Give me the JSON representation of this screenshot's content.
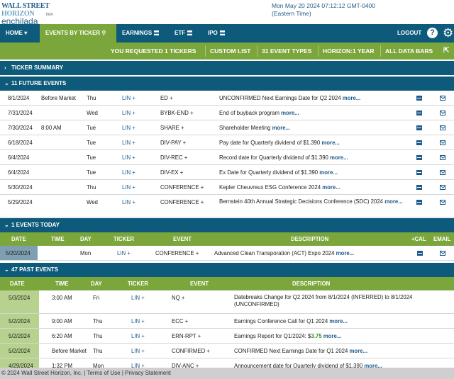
{
  "brand": {
    "line1_a": "WALL STREET ",
    "line1_b": "HORIZON",
    "line2": "enchilada",
    "tmx": "TMX"
  },
  "datetime": {
    "line1": "Mon May 20 2024 07:12:12 GMT-0400",
    "line2": "(Eastern Time)"
  },
  "nav": {
    "home": "HOME",
    "events_by_ticker": "EVENTS BY TICKER",
    "earnings": "EARNINGS",
    "etf": "ETF",
    "ipo": "IPO",
    "logout": "LOGOUT"
  },
  "subnav": {
    "requested": "YOU REQUESTED 1 TICKERS",
    "custom_list": "CUSTOM LIST",
    "event_types": "31 EVENT TYPES",
    "horizon": "HORIZON:1 YEAR",
    "data_bars": "ALL DATA BARS"
  },
  "sections": {
    "ticker_summary": "TICKER SUMMARY",
    "future": "11 FUTURE EVENTS",
    "today": "1 EVENTS TODAY",
    "past": "47 PAST EVENTS"
  },
  "more": "more...",
  "future_events": [
    {
      "date": "8/1/2024",
      "time": "Before Market",
      "day": "Thu",
      "ticker": "LIN +",
      "event": "ED +",
      "desc": "UNCONFIRMED Next Earnings Date for Q2 2024"
    },
    {
      "date": "7/31/2024",
      "time": "",
      "day": "Wed",
      "ticker": "LIN +",
      "event": "BYBK-END +",
      "desc": "End of buyback program"
    },
    {
      "date": "7/30/2024",
      "time": "8:00 AM",
      "day": "Tue",
      "ticker": "LIN +",
      "event": "SHARE +",
      "desc": "Shareholder Meeting"
    },
    {
      "date": "6/18/2024",
      "time": "",
      "day": "Tue",
      "ticker": "LIN +",
      "event": "DIV-PAY +",
      "desc": "Pay date for Quarterly dividend of $1.390"
    },
    {
      "date": "6/4/2024",
      "time": "",
      "day": "Tue",
      "ticker": "LIN +",
      "event": "DIV-REC +",
      "desc": "Record date for Quarterly dividend of $1.390"
    },
    {
      "date": "6/4/2024",
      "time": "",
      "day": "Tue",
      "ticker": "LIN +",
      "event": "DIV-EX +",
      "desc": "Ex Date for Quarterly dividend of $1.390"
    },
    {
      "date": "5/30/2024",
      "time": "",
      "day": "Thu",
      "ticker": "LIN +",
      "event": "CONFERENCE +",
      "desc": "Kepler Cheuvreux ESG Conference 2024"
    },
    {
      "date": "5/29/2024",
      "time": "",
      "day": "Wed",
      "ticker": "LIN +",
      "event": "CONFERENCE +",
      "desc": "Bernstein 40th Annual Strategic Decisions Conference (SDC) 2024"
    }
  ],
  "today_header": {
    "date": "DATE",
    "time": "TIME",
    "day": "DAY",
    "ticker": "TICKER",
    "event": "EVENT",
    "desc": "DESCRIPTION",
    "cal": "+CAL",
    "email": "EMAIL"
  },
  "today_events": [
    {
      "date": "5/20/2024",
      "time": "",
      "day": "Mon",
      "ticker": "LIN +",
      "event": "CONFERENCE +",
      "desc": "Advanced Clean Transporation (ACT) Expo 2024"
    }
  ],
  "past_header": {
    "date": "DATE",
    "time": "TIME",
    "day": "DAY",
    "ticker": "TICKER",
    "event": "EVENT",
    "desc": "DESCRIPTION"
  },
  "past_events": [
    {
      "date": "5/3/2024",
      "time": "3:00 AM",
      "day": "Fri",
      "ticker": "LIN +",
      "event": "NQ +",
      "desc": "Datebreaks Change for Q2 2024 from 8/1/2024 (INFERRED) to 8/1/2024 (UNCONFIRMED)"
    },
    {
      "date": "5/2/2024",
      "time": "9:00 AM",
      "day": "Thu",
      "ticker": "LIN +",
      "event": "ECC +",
      "desc": "Earnings Conference Call for Q1 2024"
    },
    {
      "date": "5/2/2024",
      "time": "6:20 AM",
      "day": "Thu",
      "ticker": "LIN +",
      "event": "ERN-RPT +",
      "desc": "Earnings Report for Q1/2024: $",
      "eps": "3.75"
    },
    {
      "date": "5/2/2024",
      "time": "Before Market",
      "day": "Thu",
      "ticker": "LIN +",
      "event": "CONFIRMED +",
      "desc": "CONFIRMED Next Earnings Date for Q1 2024"
    },
    {
      "date": "4/29/2024",
      "time": "1:32 PM",
      "day": "Mon",
      "ticker": "LIN +",
      "event": "DIV-ANC +",
      "desc": "Announcement date for Quarterly dividend of $1.390"
    }
  ],
  "footer": "© 2024 Wall Street Horizon, Inc. | Terms of Use | Privacy Statement",
  "colors": {
    "nav": "#0e5a7a",
    "accent_green": "#7ba63c",
    "link": "#1f5a8a"
  }
}
